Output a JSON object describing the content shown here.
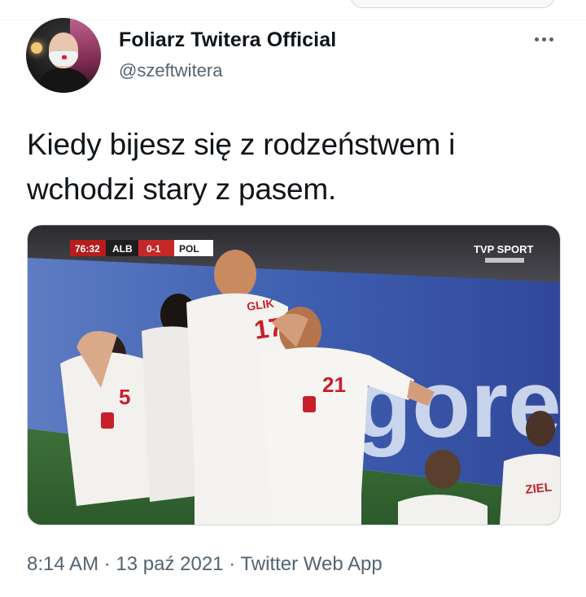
{
  "tweet": {
    "author": {
      "display_name": "Foliarz Twitera Official",
      "handle": "@szeftwitera"
    },
    "text": "Kiedy bijesz się z rodzeństwem i\nwchodzi stary z pasem.",
    "media": {
      "scoreboard": {
        "time": "76:32",
        "team_home": "ALB",
        "score": "0-1",
        "team_away": "POL"
      },
      "broadcaster_logo": "TVP SPORT",
      "ad_board_text": "gorer",
      "jersey_numbers": [
        "5",
        "17",
        "21"
      ],
      "jersey_names": [
        "GLIK",
        "ZIEL"
      ]
    },
    "timestamp": "8:14 AM",
    "date": "13 paź 2021",
    "source": "Twitter Web App",
    "separator": "·"
  },
  "icons": {
    "more": "more-horizontal-icon"
  }
}
